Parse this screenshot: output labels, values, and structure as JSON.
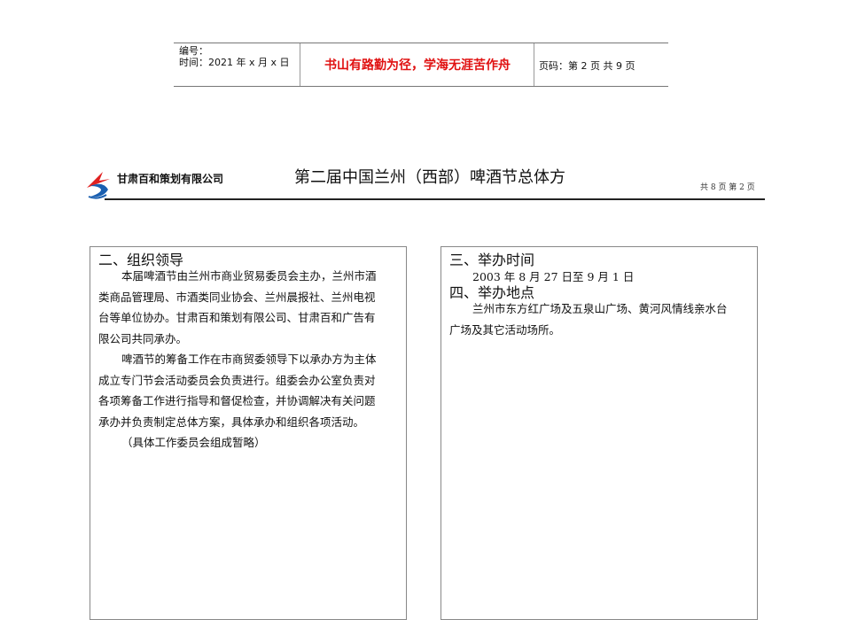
{
  "header": {
    "number_label": "编号：",
    "time_label": "时间：2021 年 x 月 x 日",
    "motto": "书山有路勤为径，学海无涯苦作舟",
    "page_code": "页码：第 2 页  共 9 页"
  },
  "doc": {
    "company": "甘肃百和策划有限公司",
    "title": "第二届中国兰州（西部）啤酒节总体方",
    "pages": "共 8 页    第 2 页"
  },
  "left": {
    "heading": "二、组织领导",
    "lines": [
      "本届啤酒节由兰州市商业贸易委员会主办，兰州市酒",
      "类商品管理局、市酒类同业协会、兰州晨报社、兰州电视",
      "台等单位协办。甘肃百和策划有限公司、甘肃百和广告有",
      "限公司共同承办。",
      "啤酒节的筹备工作在市商贸委领导下以承办方为主体",
      "成立专门节会活动委员会负责进行。组委会办公室负责对",
      "各项筹备工作进行指导和督促检查，并协调解决有关问题",
      "承办并负责制定总体方案，具体承办和组织各项活动。",
      "（具体工作委员会组成暂略）"
    ]
  },
  "right": {
    "heading_time": "三、举办时间",
    "time": "2003 年 8 月 27 日至 9 月 1 日",
    "heading_place": "四、举办地点",
    "lines": [
      "兰州市东方红广场及五泉山广场、黄河风情线亲水台",
      "广场及其它活动场所。"
    ]
  },
  "colors": {
    "motto": "#e01010",
    "logo_red": "#e02020",
    "logo_blue": "#1a5fb0"
  }
}
